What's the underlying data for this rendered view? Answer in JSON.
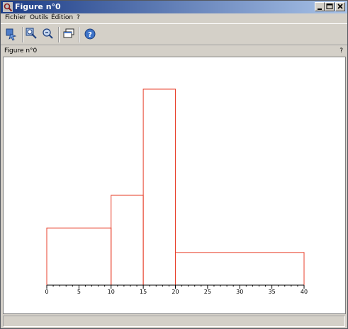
{
  "window": {
    "title": "Figure n°0"
  },
  "menu": {
    "fichier": "Fichier",
    "outils": "Outils",
    "edition": "Édition",
    "help": "?"
  },
  "infobar": {
    "label": "Figure n°0",
    "help": "?"
  },
  "colors": {
    "bars": "#e8412c",
    "axis": "#000000",
    "titlebar_start": "#1c3c86",
    "titlebar_end": "#a9c3e8"
  },
  "icons": [
    "rotate-icon",
    "zoom-in-icon",
    "zoom-out-icon",
    "windows-icon",
    "help-icon"
  ],
  "chart_data": {
    "type": "bar",
    "subtype": "histogram",
    "bins": [
      {
        "x0": 0,
        "x1": 10,
        "value": 0.35
      },
      {
        "x0": 10,
        "x1": 15,
        "value": 0.55
      },
      {
        "x0": 15,
        "x1": 20,
        "value": 1.2
      },
      {
        "x0": 20,
        "x1": 40,
        "value": 0.2
      }
    ],
    "xlim": [
      0,
      40
    ],
    "ylim": [
      0,
      1.2
    ],
    "xticks": [
      "0",
      "5",
      "10",
      "15",
      "20",
      "25",
      "30",
      "35",
      "40"
    ],
    "title": "",
    "xlabel": "",
    "ylabel": "",
    "grid": false,
    "y_axis_visible": false
  }
}
